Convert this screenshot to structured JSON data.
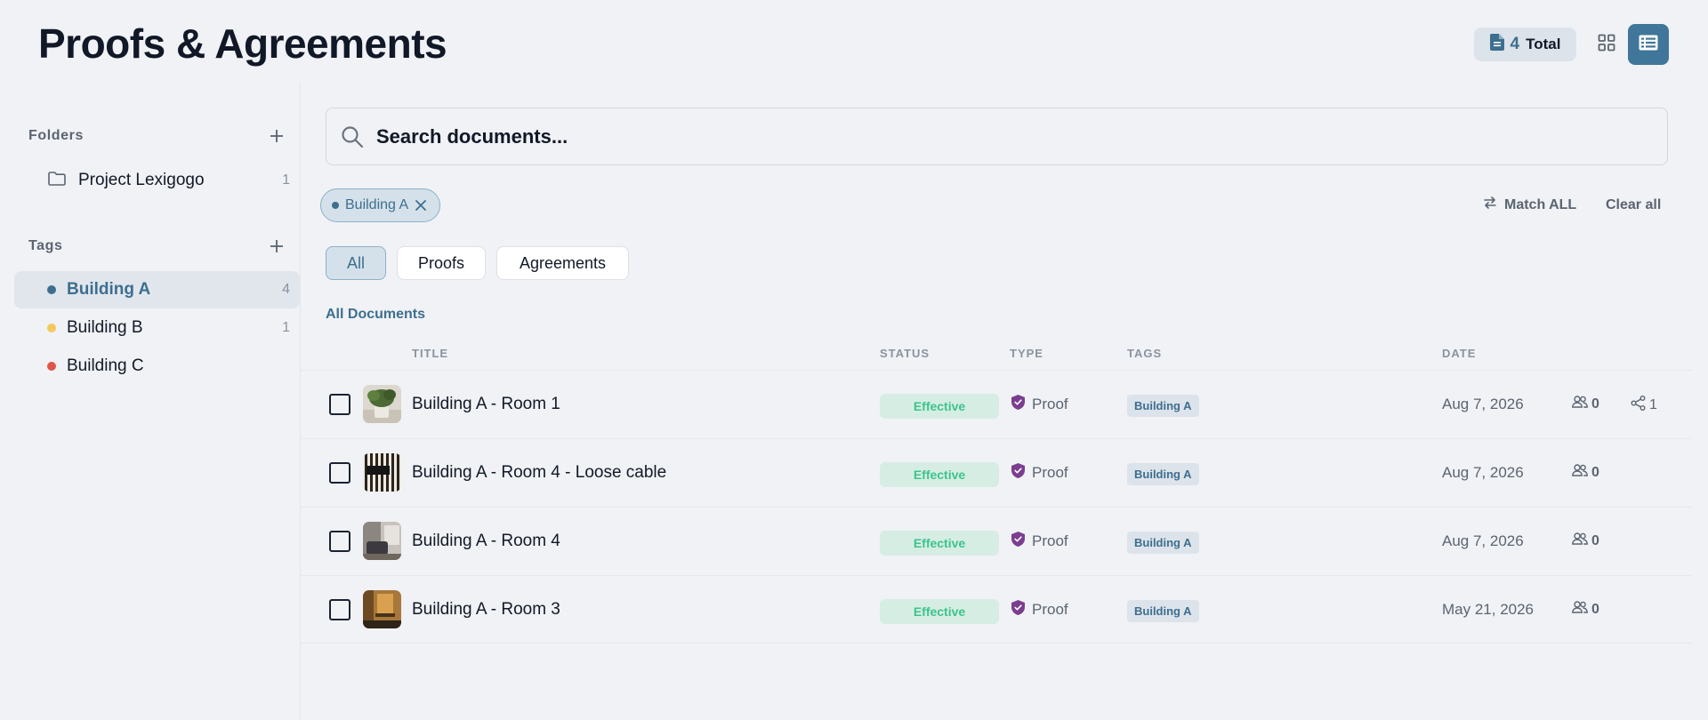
{
  "header": {
    "title": "Proofs & Agreements",
    "total_count": "4",
    "total_label": "Total",
    "accent_color": "#3f7699"
  },
  "sidebar": {
    "folders_label": "Folders",
    "folders": [
      {
        "name": "Project Lexigogo",
        "count": "1"
      }
    ],
    "tags_label": "Tags",
    "tags": [
      {
        "name": "Building A",
        "count": "4",
        "color": "#3d6f8f",
        "active": true
      },
      {
        "name": "Building B",
        "count": "1",
        "color": "#f6c75a",
        "active": false
      },
      {
        "name": "Building C",
        "count": "",
        "color": "#e0554a",
        "active": false
      }
    ]
  },
  "search": {
    "placeholder": "Search documents..."
  },
  "active_filter": {
    "chip_label": "Building A",
    "match_label": "Match ALL",
    "clear_label": "Clear all"
  },
  "filter_tabs": [
    {
      "label": "All",
      "active": true
    },
    {
      "label": "Proofs",
      "active": false
    },
    {
      "label": "Agreements",
      "active": false
    }
  ],
  "section_label": "All Documents",
  "table": {
    "columns": [
      "TITLE",
      "STATUS",
      "TYPE",
      "TAGS",
      "DATE"
    ],
    "rows": [
      {
        "title": "Building A - Room 1",
        "status": "Effective",
        "type": "Proof",
        "tag": "Building A",
        "date": "Aug 7, 2026",
        "users": "0",
        "shares": "1",
        "thumb": "plant"
      },
      {
        "title": "Building A - Room 4 - Loose cable",
        "status": "Effective",
        "type": "Proof",
        "tag": "Building A",
        "date": "Aug 7, 2026",
        "users": "0",
        "shares": "",
        "thumb": "radiator"
      },
      {
        "title": "Building A - Room 4",
        "status": "Effective",
        "type": "Proof",
        "tag": "Building A",
        "date": "Aug 7, 2026",
        "users": "0",
        "shares": "",
        "thumb": "room"
      },
      {
        "title": "Building A - Room 3",
        "status": "Effective",
        "type": "Proof",
        "tag": "Building A",
        "date": "May 21, 2026",
        "users": "0",
        "shares": "",
        "thumb": "wood"
      }
    ]
  }
}
